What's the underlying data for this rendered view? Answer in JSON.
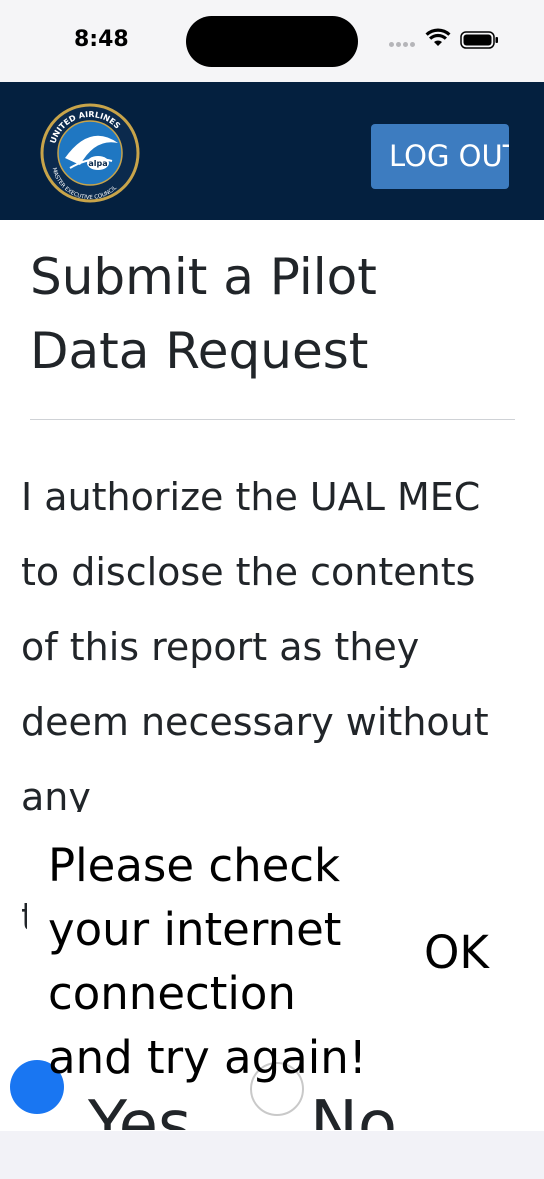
{
  "status_bar": {
    "time": "8:48",
    "icons": [
      "signal-dots-icon",
      "wifi-icon",
      "battery-icon"
    ]
  },
  "header": {
    "logo_name": "united-airlines-alpa-mec-logo",
    "logo_text": "UNITED AIRLINES MASTER EXECUTIVE COUNCIL alpa",
    "logout_label": "LOG OUT",
    "background_color": "#04203f",
    "button_color": "#3d7cc0"
  },
  "page": {
    "title": "Submit a Pilot Data Request",
    "authorization_text": "I authorize the UAL MEC to disclose the contents of this report as they deem necessary without any",
    "hidden_fragment": "t"
  },
  "radio_group": {
    "yes_label": "Yes",
    "no_label": "No",
    "selected": "Yes",
    "accent_color": "#1976f2"
  },
  "snackbar": {
    "message": "Please check your internet connection and try again!",
    "action_label": "OK"
  }
}
